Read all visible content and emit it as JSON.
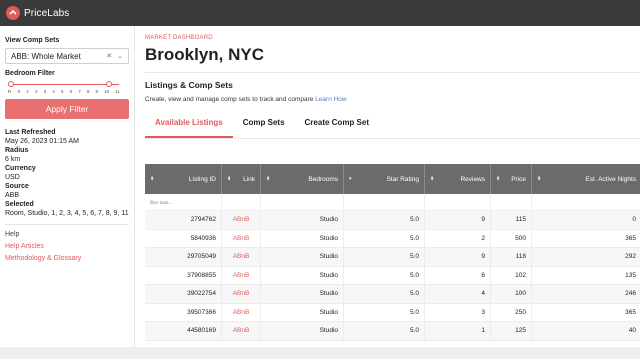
{
  "app": {
    "logo_text": "PriceLabs"
  },
  "sidebar": {
    "comp_sets_label": "View Comp Sets",
    "comp_set_value": "ABB: Whole Market",
    "bedroom_filter_label": "Bedroom Filter",
    "bedroom_ticks": [
      "R",
      "S",
      "1",
      "2",
      "3",
      "4",
      "5",
      "6",
      "7",
      "8",
      "9",
      "10",
      "11"
    ],
    "bedroom_range_selected": [
      "R",
      "11"
    ],
    "apply_label": "Apply Filter",
    "last_refreshed_label": "Last Refreshed",
    "last_refreshed_value": "May 26, 2023 01:15 AM",
    "radius_label": "Radius",
    "radius_value": "6 km",
    "currency_label": "Currency",
    "currency_value": "USD",
    "source_label": "Source",
    "source_value": "ABB",
    "selected_label": "Selected",
    "selected_value": "Room, Studio, 1, 2, 3, 4, 5, 6, 7, 8, 9, 11",
    "help_label": "Help",
    "help_articles_label": "Help Articles",
    "methodology_label": "Methodology & Glossary"
  },
  "main": {
    "breadcrumb": "MARKET DASHBOARD",
    "title": "Brooklyn, NYC",
    "section_title": "Listings & Comp Sets",
    "section_desc": "Create, view and manage comp sets to track and compare",
    "learn_how": "Learn How",
    "tabs": [
      {
        "label": "Available Listings",
        "active": true
      },
      {
        "label": "Comp Sets",
        "active": false
      },
      {
        "label": "Create Comp Set",
        "active": false
      }
    ]
  },
  "table": {
    "headers": [
      "Listing ID",
      "Link",
      "Bedrooms",
      "Star Rating",
      "Reviews",
      "Price",
      "Est. Active Nights"
    ],
    "filter_placeholder": "filter data...",
    "rows": [
      [
        "2794762",
        "ABnB",
        "Studio",
        "5.0",
        "9",
        "115",
        "0"
      ],
      [
        "5840936",
        "ABnB",
        "Studio",
        "5.0",
        "2",
        "500",
        "365"
      ],
      [
        "29705049",
        "ABnB",
        "Studio",
        "5.0",
        "9",
        "118",
        "292"
      ],
      [
        "37908855",
        "ABnB",
        "Studio",
        "5.0",
        "6",
        "102",
        "135"
      ],
      [
        "39022754",
        "ABnB",
        "Studio",
        "5.0",
        "4",
        "100",
        "246"
      ],
      [
        "39507366",
        "ABnB",
        "Studio",
        "5.0",
        "3",
        "250",
        "365"
      ],
      [
        "44580169",
        "ABnB",
        "Studio",
        "5.0",
        "1",
        "125",
        "40"
      ]
    ]
  },
  "colors": {
    "accent": "#e05a5a",
    "header_bg": "#6b6b6b",
    "topbar": "#3a3a3a"
  }
}
